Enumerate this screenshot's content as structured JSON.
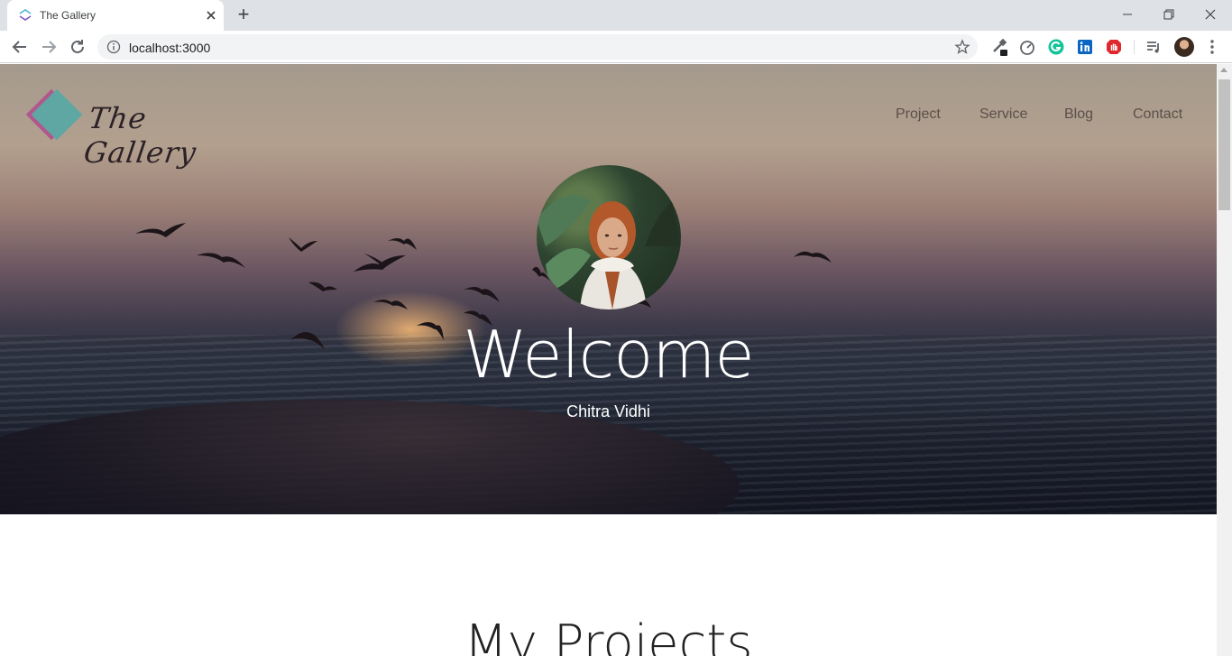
{
  "browser": {
    "tab_title": "The Gallery",
    "new_tab_label": "+",
    "url": "localhost:3000"
  },
  "site": {
    "logo_text": "The Gallery",
    "nav": [
      "Project",
      "Service",
      "Blog",
      "Contact"
    ],
    "hero": {
      "title": "Welcome",
      "subtitle": "Chitra Vidhi"
    },
    "projects_title": "My Projects"
  },
  "colors": {
    "logo_teal": "#5ea7a3",
    "logo_pink": "#b0588d"
  }
}
